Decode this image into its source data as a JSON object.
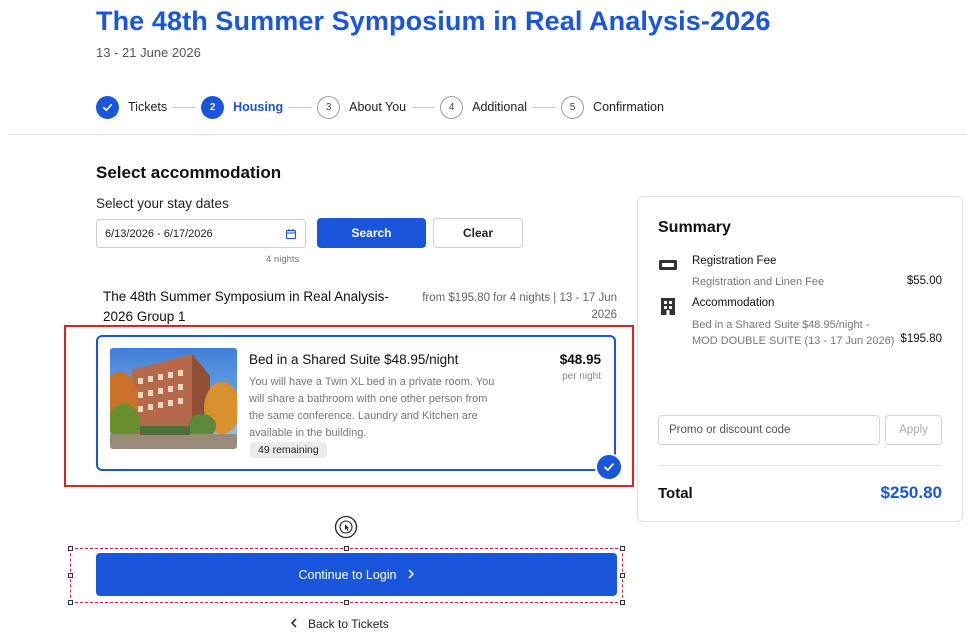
{
  "header": {
    "title": "The 48th Summer Symposium in Real Analysis-2026",
    "dates": "13 - 21 June 2026"
  },
  "stepper": {
    "steps": [
      {
        "number": "",
        "label": "Tickets",
        "state": "done",
        "icon": "check-icon"
      },
      {
        "number": "2",
        "label": "Housing",
        "state": "active"
      },
      {
        "number": "3",
        "label": "About You",
        "state": "todo"
      },
      {
        "number": "4",
        "label": "Additional",
        "state": "todo"
      },
      {
        "number": "5",
        "label": "Confirmation",
        "state": "todo"
      }
    ]
  },
  "accommodation": {
    "title": "Select accommodation",
    "stay_label": "Select your stay dates",
    "date_value": "6/13/2026 - 6/17/2026",
    "nights": "4 nights",
    "search_label": "Search",
    "clear_label": "Clear",
    "group": {
      "title": "The 48th Summer Symposium in Real Analysis-2026 Group 1",
      "price_info": "from $195.80 for 4 nights | 13 - 17 Jun 2026"
    },
    "room": {
      "name": "Bed in a Shared Suite $48.95/night",
      "description": "You will have a Twin XL bed in a private room. You will share a bathroom with one other person from the same conference. Laundry and Kitchen are available in the building.",
      "remaining": "49 remaining",
      "price": "$48.95",
      "per": "per night",
      "selected": true
    }
  },
  "actions": {
    "continue_label": "Continue to Login",
    "back_label": "Back to Tickets"
  },
  "summary": {
    "title": "Summary",
    "registration": {
      "title": "Registration Fee",
      "detail": "Registration and Linen Fee",
      "amount": "$55.00"
    },
    "accommodation": {
      "title": "Accommodation",
      "detail": "Bed in a Shared Suite $48.95/night - MOD DOUBLE SUITE (13 - 17 Jun 2026)",
      "amount": "$195.80"
    },
    "promo_placeholder": "Promo or discount code",
    "apply_label": "Apply",
    "total_label": "Total",
    "total_amount": "$250.80"
  },
  "colors": {
    "accent": "#1a56db",
    "highlight": "#d9232e"
  }
}
